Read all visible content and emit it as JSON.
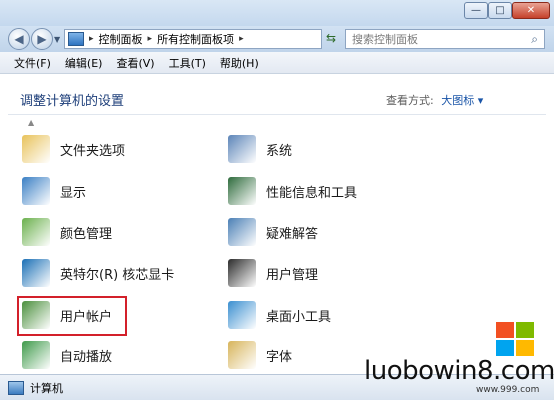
{
  "window": {
    "controls": {
      "minimize": "—",
      "maximize": "□",
      "close": "✕"
    }
  },
  "nav": {
    "back_icon": "back-arrow-icon",
    "forward_icon": "forward-arrow-icon",
    "breadcrumbs": [
      "控制面板",
      "所有控制面板项"
    ],
    "search_placeholder": "搜索控制面板"
  },
  "menu": [
    "文件(F)",
    "编辑(E)",
    "查看(V)",
    "工具(T)",
    "帮助(H)"
  ],
  "main": {
    "title": "调整计算机的设置",
    "view_by_label": "查看方式:",
    "view_by_value": "大图标 ▾",
    "left_items": [
      {
        "label": "文件夹选项",
        "icon": "folder-options-icon",
        "color": "#e8c25a"
      },
      {
        "label": "显示",
        "icon": "display-icon",
        "color": "#3a7fc4"
      },
      {
        "label": "颜色管理",
        "icon": "color-management-icon",
        "color": "#6ab04c"
      },
      {
        "label": "英特尔(R) 核芯显卡",
        "icon": "intel-graphics-icon",
        "color": "#1a6fb5"
      },
      {
        "label": "用户帐户",
        "icon": "user-accounts-icon",
        "color": "#4a8f3c"
      },
      {
        "label": "自动播放",
        "icon": "autoplay-icon",
        "color": "#3e9a4a"
      }
    ],
    "right_items": [
      {
        "label": "系统",
        "icon": "system-icon",
        "color": "#5b84b8"
      },
      {
        "label": "性能信息和工具",
        "icon": "performance-icon",
        "color": "#2e6b3c"
      },
      {
        "label": "疑难解答",
        "icon": "troubleshooting-icon",
        "color": "#4a7fb5"
      },
      {
        "label": "用户管理",
        "icon": "user-management-icon",
        "color": "#2b2b2b"
      },
      {
        "label": "桌面小工具",
        "icon": "desktop-gadgets-icon",
        "color": "#3a8fd0"
      },
      {
        "label": "字体",
        "icon": "fonts-icon",
        "color": "#d7b45a"
      }
    ]
  },
  "status": {
    "label": "计算机"
  },
  "watermark": {
    "text": "luobowin8.com",
    "sub": "www.999.com"
  }
}
